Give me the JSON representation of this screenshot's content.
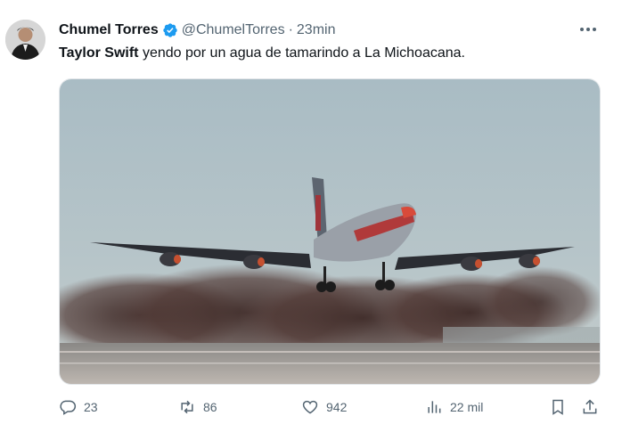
{
  "tweet": {
    "author_name": "Chumel Torres",
    "handle": "@ChumelTorres",
    "separator": "·",
    "time": "23min",
    "mention": "Taylor Swift",
    "text": " yendo por un agua de tamarindo a La Michoacana."
  },
  "actions": {
    "replies": "23",
    "retweets": "86",
    "likes": "942",
    "views": "22 mil"
  },
  "colors": {
    "verified": "#1d9bf0",
    "secondary_text": "#536471",
    "primary_text": "#0f1419"
  },
  "icons": [
    "verified-badge-icon",
    "more-icon",
    "reply-icon",
    "retweet-icon",
    "like-icon",
    "views-icon",
    "bookmark-icon",
    "share-icon"
  ]
}
